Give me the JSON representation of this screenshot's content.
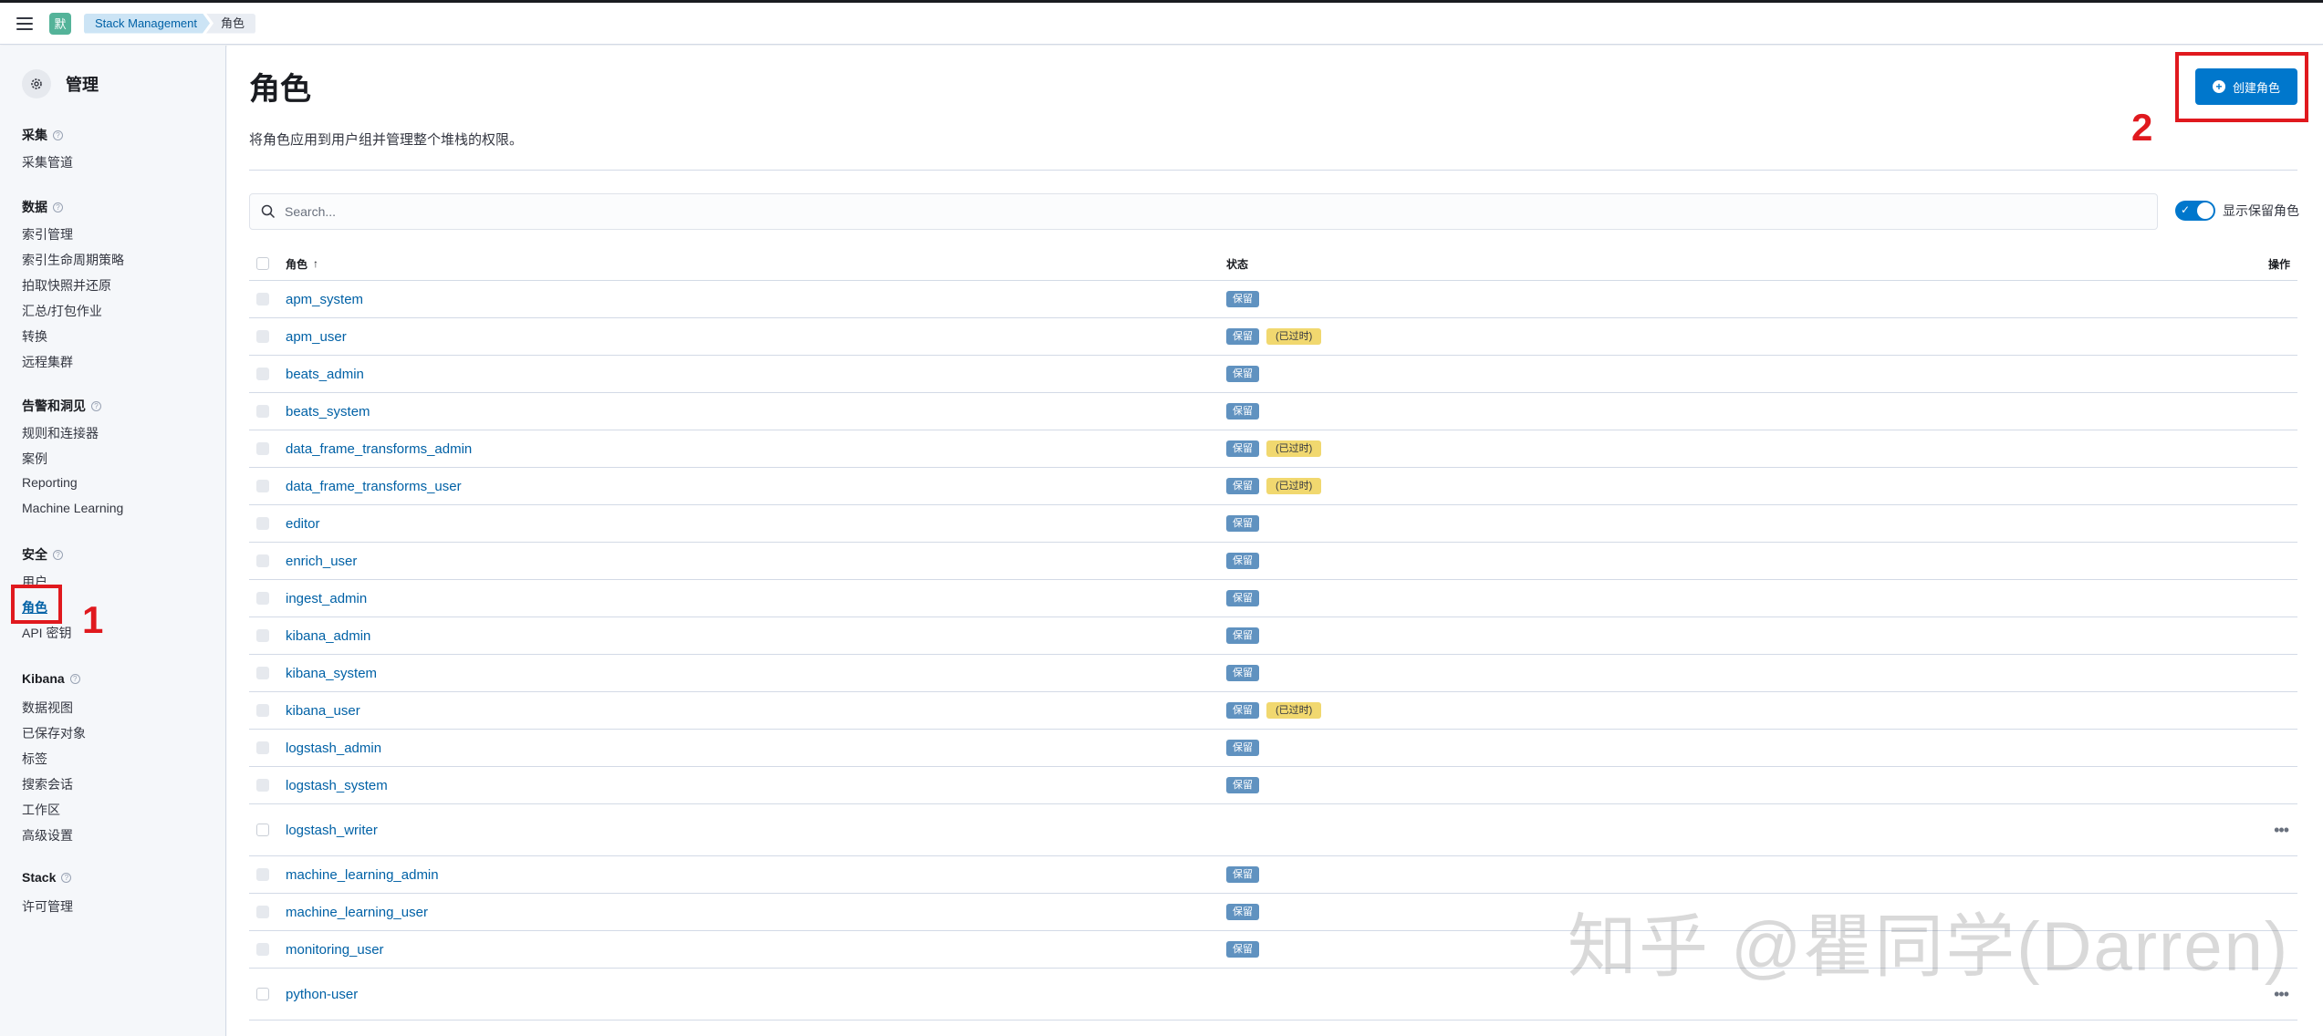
{
  "header": {
    "space_initial": "默",
    "breadcrumb": [
      "Stack Management",
      "角色"
    ]
  },
  "sidebar": {
    "title": "管理",
    "groups": [
      {
        "title": "采集",
        "items": [
          "采集管道"
        ]
      },
      {
        "title": "数据",
        "items": [
          "索引管理",
          "索引生命周期策略",
          "拍取快照并还原",
          "汇总/打包作业",
          "转换",
          "远程集群"
        ]
      },
      {
        "title": "告警和洞见",
        "items": [
          "规则和连接器",
          "案例",
          "Reporting",
          "Machine Learning"
        ]
      },
      {
        "title": "安全",
        "items": [
          "用户",
          "角色",
          "API 密钥"
        ]
      },
      {
        "title": "Kibana",
        "items": [
          "数据视图",
          "已保存对象",
          "标签",
          "搜索会话",
          "工作区",
          "高级设置"
        ]
      },
      {
        "title": "Stack",
        "items": [
          "许可管理"
        ]
      }
    ]
  },
  "main": {
    "title": "角色",
    "description": "将角色应用到用户组并管理整个堆栈的权限。",
    "create_button": "创建角色",
    "search_placeholder": "Search...",
    "toggle_label": "显示保留角色",
    "columns": {
      "role": "角色",
      "sort": "↑",
      "status": "状态",
      "actions": "操作"
    },
    "badges": {
      "reserved": "保留",
      "deprecated": "(已过时)"
    },
    "rows": [
      {
        "name": "apm_system",
        "reserved": true,
        "deprecated": false
      },
      {
        "name": "apm_user",
        "reserved": true,
        "deprecated": true
      },
      {
        "name": "beats_admin",
        "reserved": true,
        "deprecated": false
      },
      {
        "name": "beats_system",
        "reserved": true,
        "deprecated": false
      },
      {
        "name": "data_frame_transforms_admin",
        "reserved": true,
        "deprecated": true
      },
      {
        "name": "data_frame_transforms_user",
        "reserved": true,
        "deprecated": true
      },
      {
        "name": "editor",
        "reserved": true,
        "deprecated": false
      },
      {
        "name": "enrich_user",
        "reserved": true,
        "deprecated": false
      },
      {
        "name": "ingest_admin",
        "reserved": true,
        "deprecated": false
      },
      {
        "name": "kibana_admin",
        "reserved": true,
        "deprecated": false
      },
      {
        "name": "kibana_system",
        "reserved": true,
        "deprecated": false
      },
      {
        "name": "kibana_user",
        "reserved": true,
        "deprecated": true
      },
      {
        "name": "logstash_admin",
        "reserved": true,
        "deprecated": false
      },
      {
        "name": "logstash_system",
        "reserved": true,
        "deprecated": false
      },
      {
        "name": "logstash_writer",
        "reserved": false,
        "deprecated": false
      },
      {
        "name": "machine_learning_admin",
        "reserved": true,
        "deprecated": false
      },
      {
        "name": "machine_learning_user",
        "reserved": true,
        "deprecated": false
      },
      {
        "name": "monitoring_user",
        "reserved": true,
        "deprecated": false
      },
      {
        "name": "python-user",
        "reserved": false,
        "deprecated": false
      }
    ]
  },
  "annotations": {
    "step1": "1",
    "step2": "2"
  },
  "watermark": "知乎 @瞿同学(Darren)",
  "colors": {
    "accent": "#0077cc",
    "reserved_badge": "#6092c0",
    "deprecated_badge": "#f1d86f",
    "annotation": "#e0191e"
  }
}
